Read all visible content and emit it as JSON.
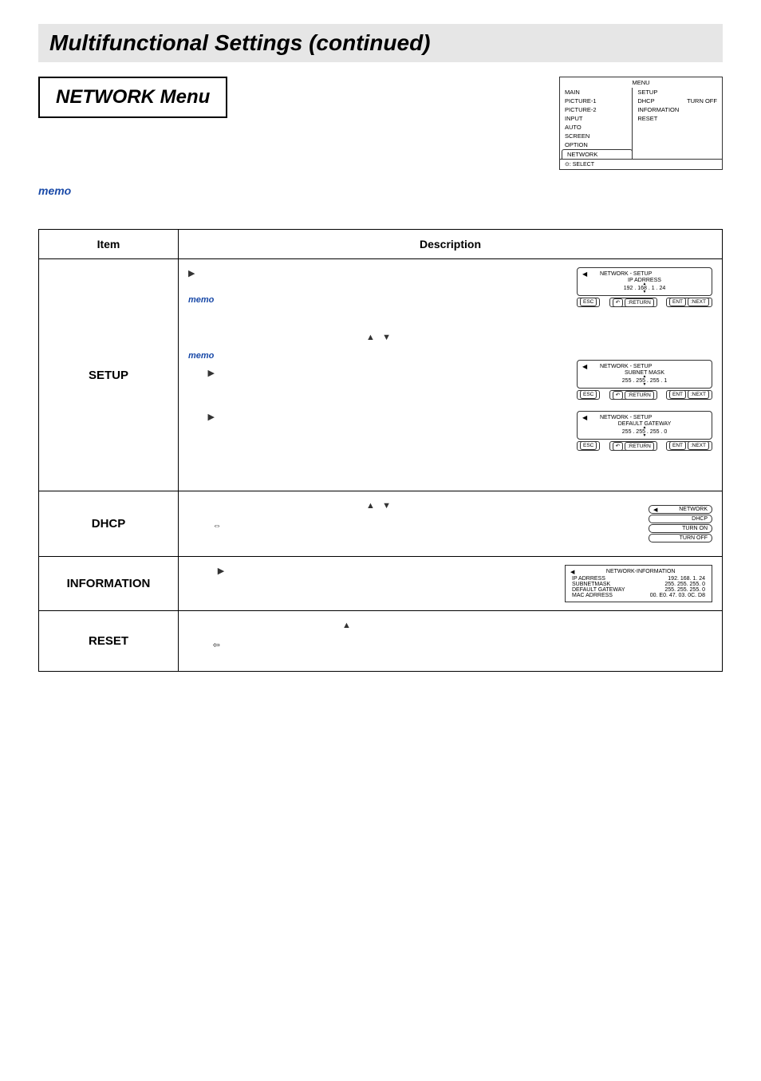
{
  "header": {
    "title": "Multifunctional Settings (continued)"
  },
  "menu_title": "NETWORK Menu",
  "memo_label": "memo",
  "osd_top": {
    "title": "MENU",
    "left": [
      "MAIN",
      "PICTURE-1",
      "PICTURE-2",
      "INPUT",
      "AUTO",
      "SCREEN",
      "OPTION",
      "NETWORK"
    ],
    "right_col": [
      "SETUP",
      "DHCP",
      "INFORMATION",
      "RESET"
    ],
    "right_extra": "TURN OFF",
    "bottom": ": SELECT"
  },
  "table": {
    "headers": {
      "item": "Item",
      "desc": "Description"
    },
    "rows": [
      {
        "item": "SETUP",
        "osd1": {
          "head": "NETWORK - SETUP",
          "line1": "IP ADRRESS",
          "value": "192 . 168 .   1 .   24",
          "ret": ":RETURN",
          "nxt": ":NEXT",
          "esc": "ESC",
          "ent": "ENT"
        },
        "osd2": {
          "head": "NETWORK - SETUP",
          "line1": "SUBNET MASK",
          "value": "255 . 255 . 255 .    1",
          "ret": ":RETURN",
          "nxt": ":NEXT",
          "esc": "ESC",
          "ent": "ENT"
        },
        "osd3": {
          "head": "NETWORK - SETUP",
          "line1": "DEFAULT GATEWAY",
          "value": "255 . 255 . 255 .    0",
          "ret": ":RETURN",
          "nxt": ":NEXT",
          "esc": "ESC",
          "ent": "ENT"
        }
      },
      {
        "item": "DHCP",
        "osd": {
          "l1": "NETWORK",
          "l2": "DHCP",
          "l3": "TURN ON",
          "l4": "TURN OFF"
        }
      },
      {
        "item": "INFORMATION",
        "osd": {
          "head": "NETWORK-INFORMATION",
          "rows": [
            {
              "k": "IP ADRRESS",
              "v": "192. 168. 1. 24"
            },
            {
              "k": "SUBNETMASK",
              "v": "255. 255. 255. 0"
            },
            {
              "k": "DEFAULT GATEWAY",
              "v": "255. 255. 255. 0"
            },
            {
              "k": "MAC ADRRESS",
              "v": "00. E0. 47. 03. 0C. D8"
            }
          ]
        }
      },
      {
        "item": "RESET"
      }
    ]
  },
  "glyphs": {
    "tri_right": "▶",
    "tri_up": "▲",
    "tri_down": "▼",
    "tri_left": "◀",
    "arr_lr": "⇔",
    "arr_l": "⇦",
    "joy": "⊙",
    "undo": "↶"
  }
}
